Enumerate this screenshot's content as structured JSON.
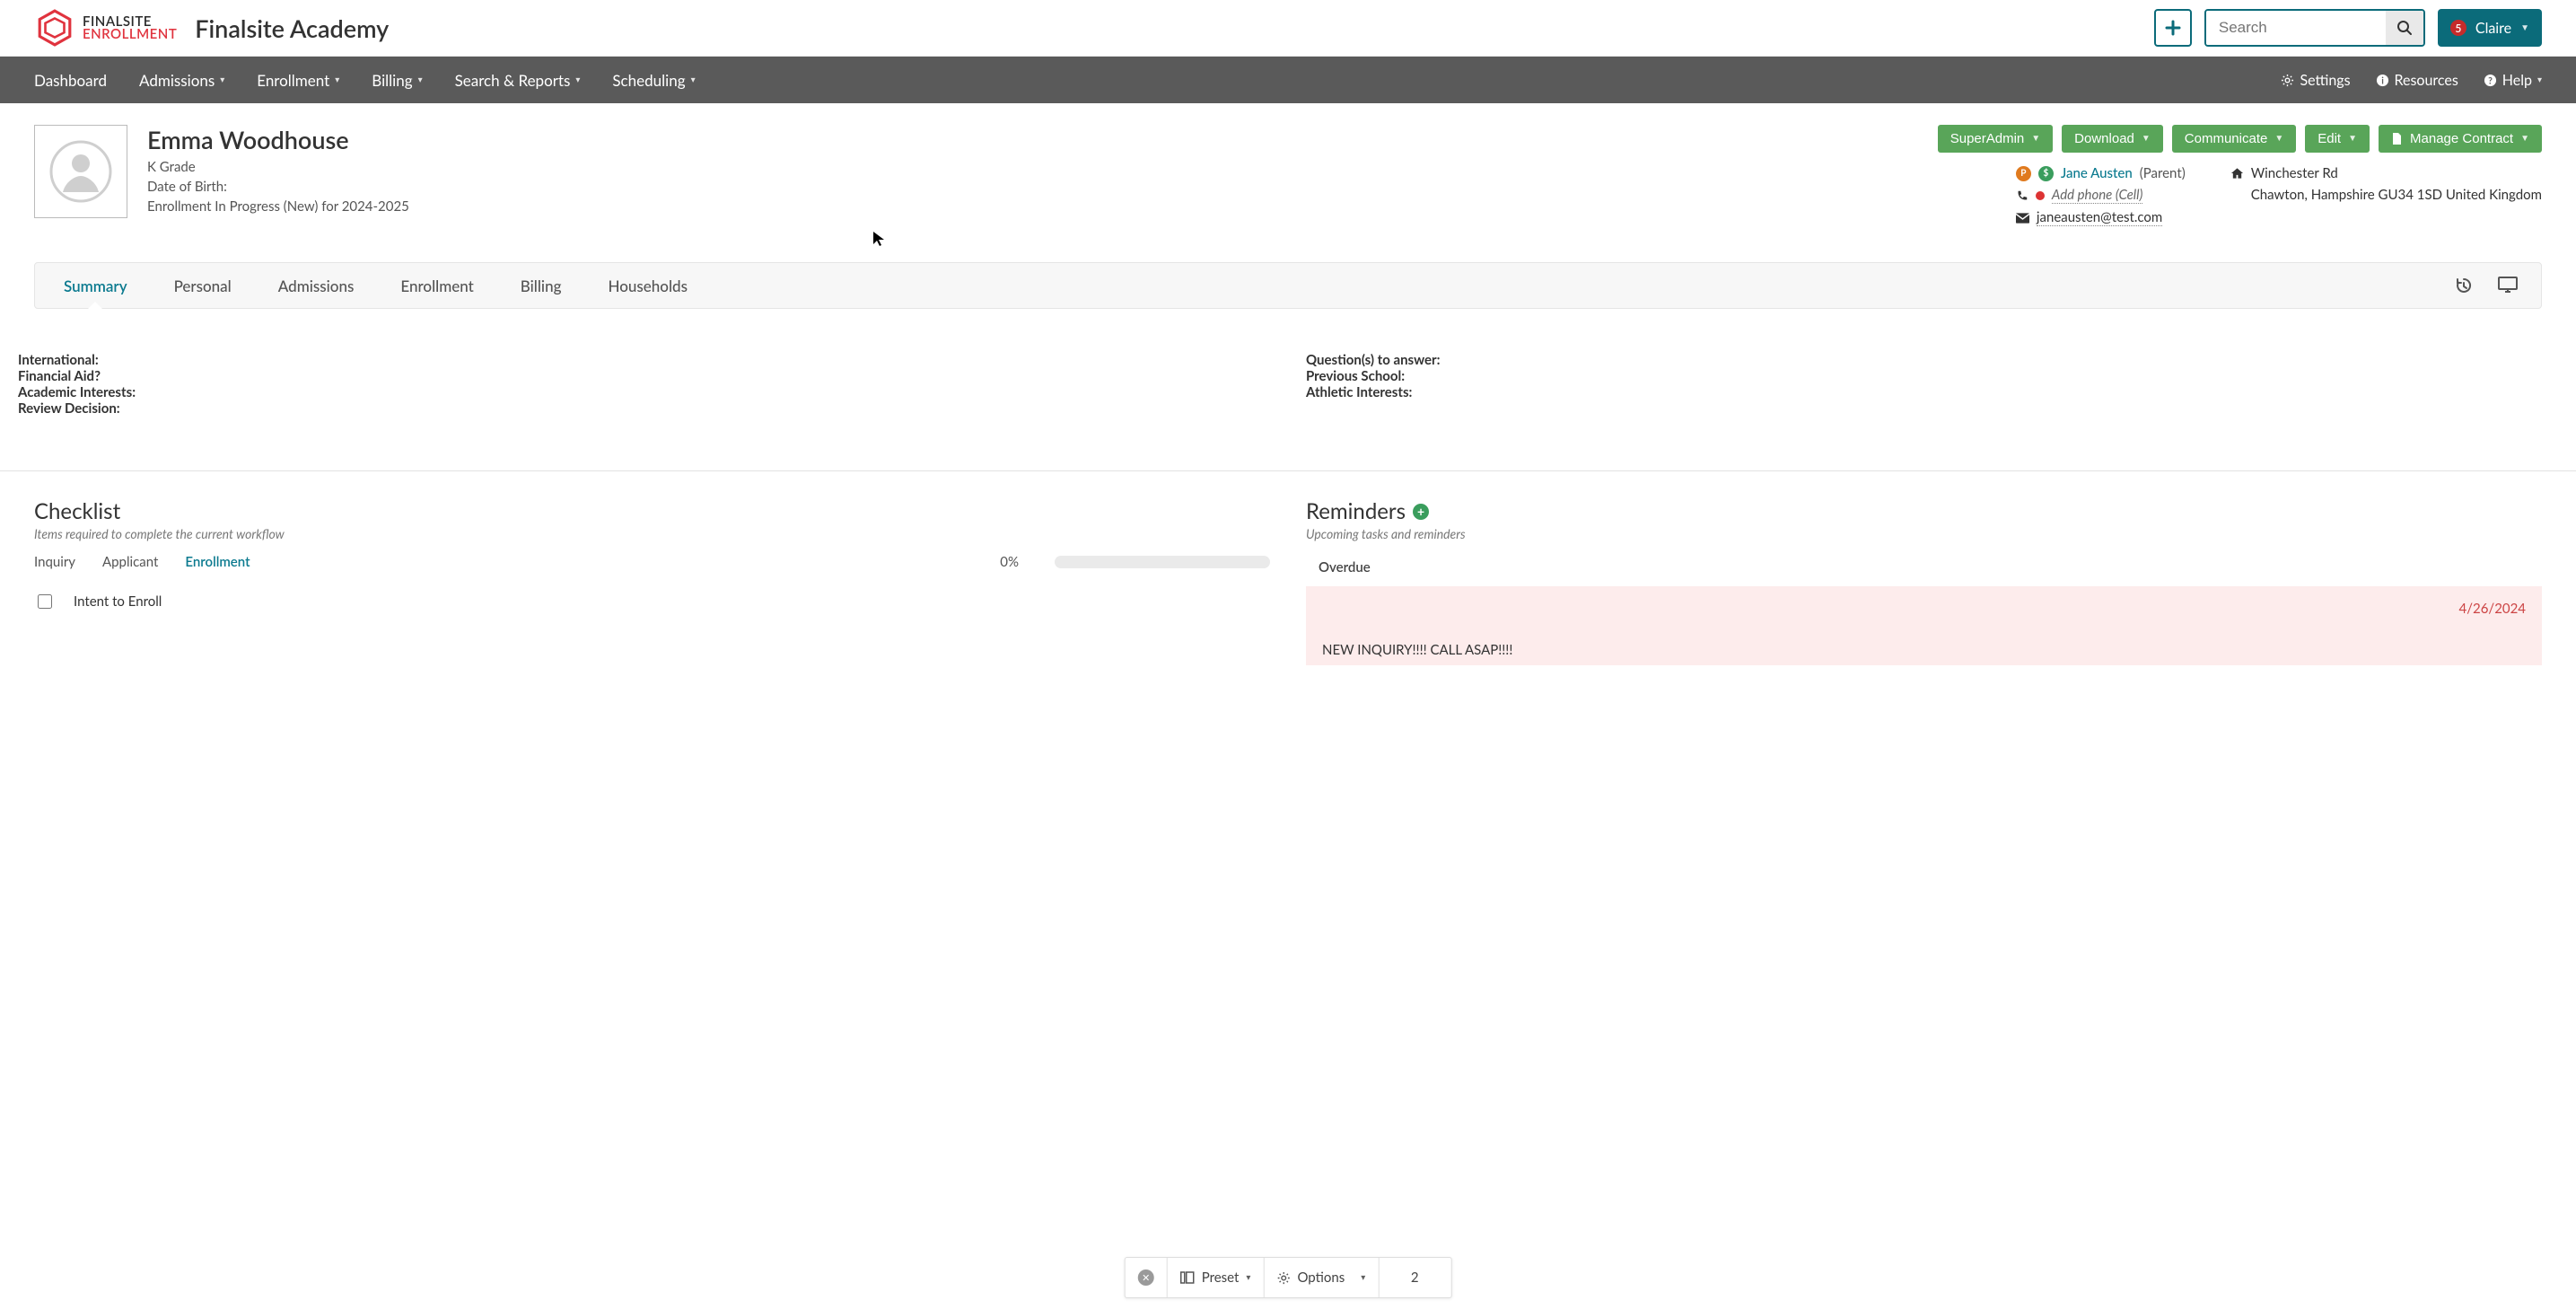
{
  "brand": {
    "line1": "FINALSITE",
    "line2": "ENROLLMENT"
  },
  "site_title": "Finalsite Academy",
  "search": {
    "placeholder": "Search"
  },
  "user": {
    "name": "Claire",
    "badge_count": "5"
  },
  "nav": {
    "items": [
      "Dashboard",
      "Admissions",
      "Enrollment",
      "Billing",
      "Search & Reports",
      "Scheduling"
    ],
    "right": {
      "settings": "Settings",
      "resources": "Resources",
      "help": "Help"
    }
  },
  "student": {
    "name": "Emma Woodhouse",
    "grade": "K Grade",
    "dob_label": "Date of Birth:",
    "status": "Enrollment In Progress (New) for 2024-2025"
  },
  "action_buttons": {
    "superadmin": "SuperAdmin",
    "download": "Download",
    "communicate": "Communicate",
    "edit": "Edit",
    "manage_contract": "Manage Contract"
  },
  "contact": {
    "parent_name": "Jane Austen",
    "parent_role": "(Parent)",
    "phone_link": "Add phone (Cell)",
    "email": "janeausten@test.com",
    "addr_line1": "Winchester Rd",
    "addr_line2": "Chawton, Hampshire GU34 1SD United Kingdom"
  },
  "subtabs": [
    "Summary",
    "Personal",
    "Admissions",
    "Enrollment",
    "Billing",
    "Households"
  ],
  "info_fields": {
    "left": [
      "International:",
      "Financial Aid?",
      "Academic Interests:",
      "Review Decision:"
    ],
    "right": [
      "Question(s) to answer:",
      "Previous School:",
      "Athletic Interests:"
    ]
  },
  "checklist": {
    "title": "Checklist",
    "subtitle": "Items required to complete the current workflow",
    "tabs": [
      "Inquiry",
      "Applicant",
      "Enrollment"
    ],
    "progress_pct": "0%",
    "items": [
      "Intent to Enroll"
    ]
  },
  "reminders": {
    "title": "Reminders",
    "subtitle": "Upcoming tasks and reminders",
    "overdue_label": "Overdue",
    "overdue_date": "4/26/2024",
    "overdue_text": "NEW INQUIRY!!!! CALL ASAP!!!!"
  },
  "toolbar": {
    "preset": "Preset",
    "options": "Options",
    "count": "2"
  }
}
